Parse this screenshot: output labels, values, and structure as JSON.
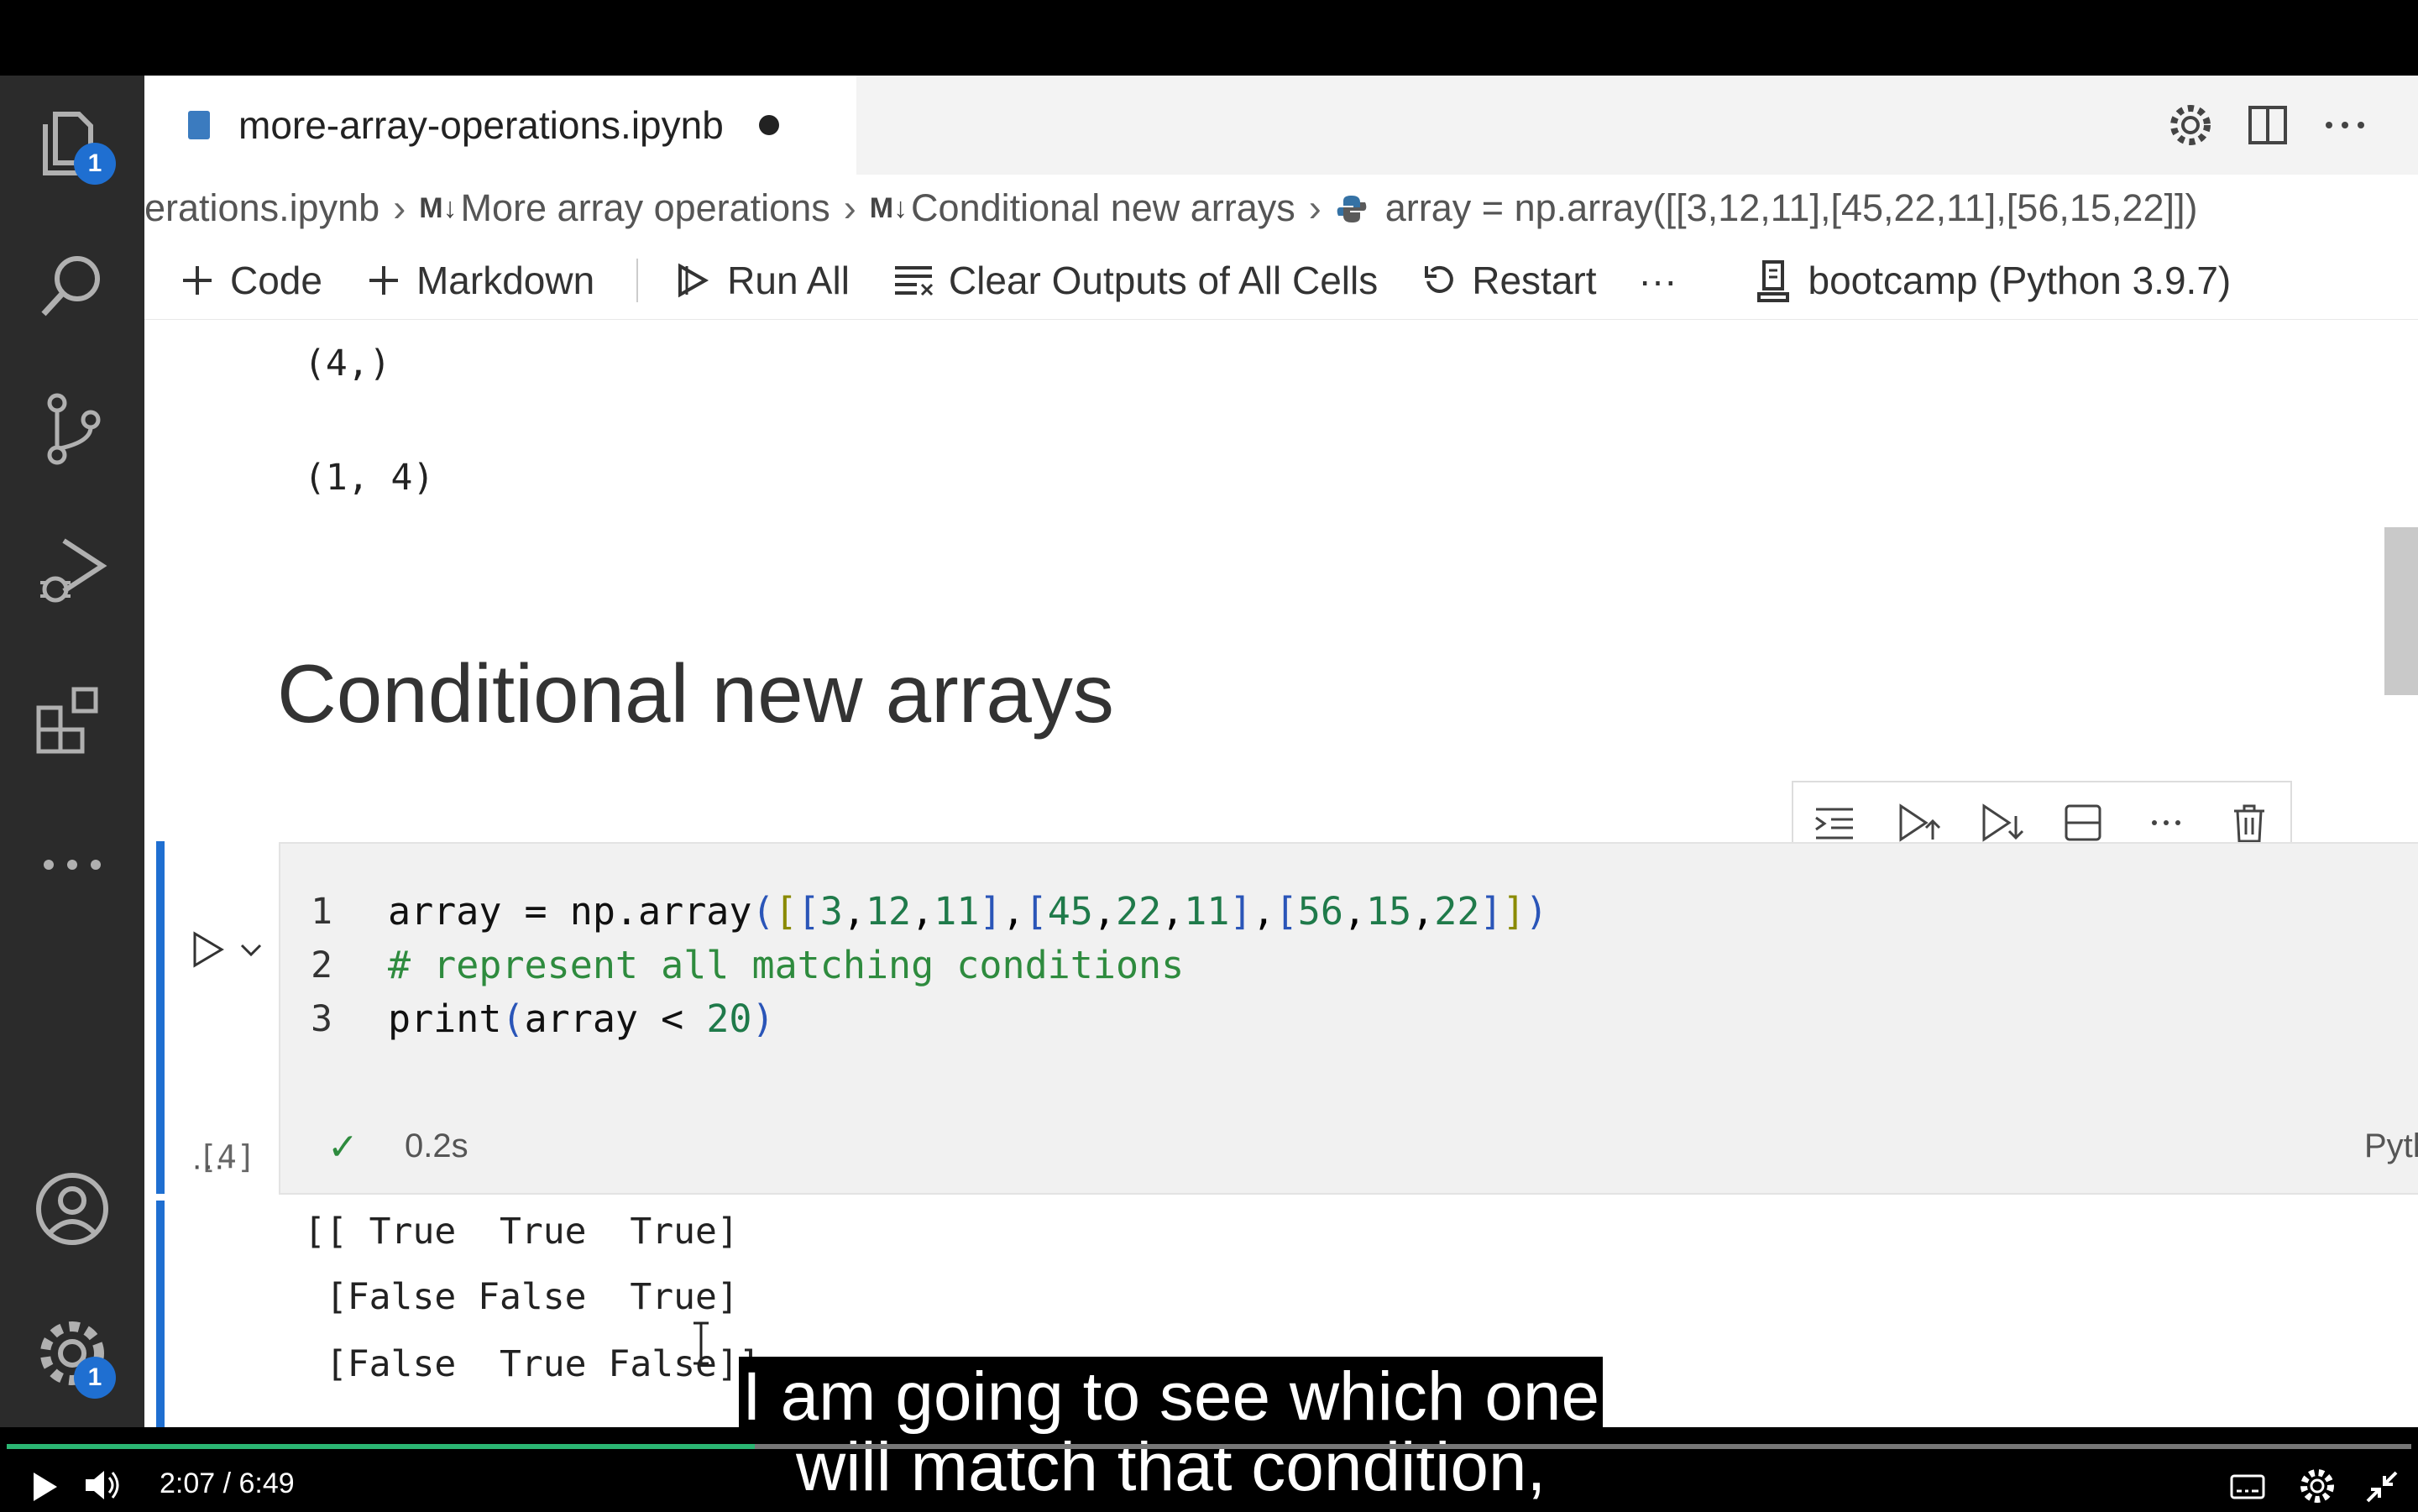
{
  "tab": {
    "title": "more-array-operations.ipynb"
  },
  "breadcrumb": {
    "file": "erations.ipynb",
    "md1_prefix": "M↓",
    "md1": "More array operations",
    "md2_prefix": "M↓",
    "md2": "Conditional new arrays",
    "code": "array = np.array([[3,12,11],[45,22,11],[56,15,22]])"
  },
  "toolbar": {
    "code": "Code",
    "markdown": "Markdown",
    "run_all": "Run All",
    "clear": "Clear Outputs of All Cells",
    "restart": "Restart",
    "more": "···",
    "kernel": "bootcamp (Python 3.9.7)"
  },
  "badges": {
    "explorer": "1",
    "settings": "1"
  },
  "prev_output": {
    "line1": "(4,)",
    "line2": "(1, 4)"
  },
  "heading": "Conditional new arrays",
  "cell": {
    "line_numbers": [
      "1",
      "2",
      "3"
    ],
    "exec_count": "[4]",
    "status": "✓",
    "duration": "0.2s",
    "language": "Python"
  },
  "output": {
    "menu": "···",
    "lines": [
      "[[ True  True  True]",
      " [False False  True]",
      " [False  True False]]"
    ]
  },
  "subtitles": {
    "line1": "I am going to see which one",
    "line2": "will match that condition,"
  },
  "player": {
    "time": "2:07  /  6:49",
    "progress": 0.311
  },
  "colors": {
    "accent": "#1f6fd1",
    "progress": "#2bb673"
  }
}
